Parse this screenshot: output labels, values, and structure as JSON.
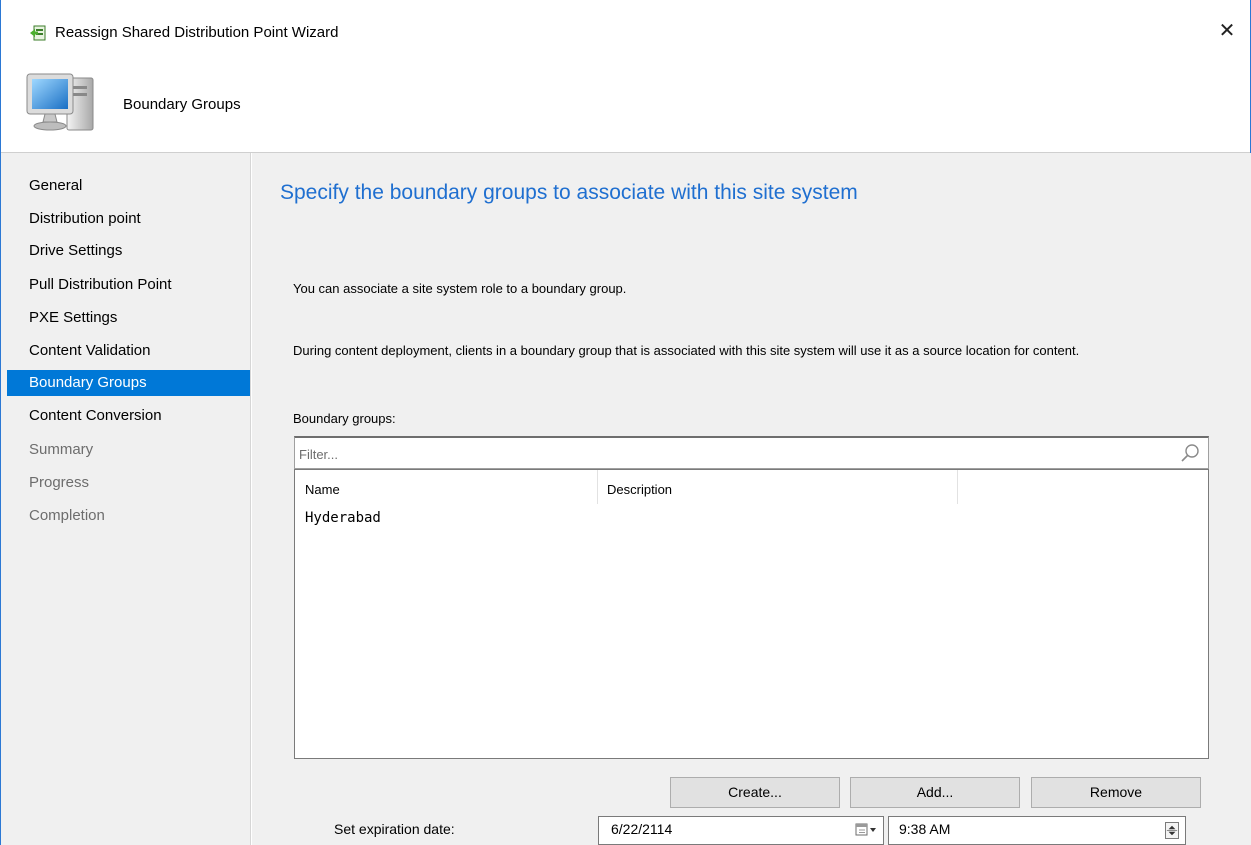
{
  "window": {
    "title": "Reassign Shared Distribution Point Wizard",
    "close_glyph": "✕"
  },
  "header": {
    "page_title": "Boundary Groups"
  },
  "nav": {
    "items": [
      {
        "label": "General",
        "state": "completed"
      },
      {
        "label": "Distribution point",
        "state": "completed"
      },
      {
        "label": "Drive Settings",
        "state": "completed"
      },
      {
        "label": "Pull Distribution Point",
        "state": "completed"
      },
      {
        "label": "PXE Settings",
        "state": "completed"
      },
      {
        "label": "Content Validation",
        "state": "completed"
      },
      {
        "label": "Boundary Groups",
        "state": "active"
      },
      {
        "label": "Content Conversion",
        "state": "completed"
      },
      {
        "label": "Summary",
        "state": "disabled"
      },
      {
        "label": "Progress",
        "state": "disabled"
      },
      {
        "label": "Completion",
        "state": "disabled"
      }
    ]
  },
  "main": {
    "heading": "Specify the boundary groups to associate with this site system",
    "intro": "You can associate a site system role to a boundary group.",
    "details": "During content deployment, clients in a boundary group that is associated with this site system will use it as a source location for content.",
    "list_label": "Boundary groups:",
    "filter": {
      "placeholder": "Filter...",
      "value": ""
    },
    "columns": [
      "Name",
      "Description"
    ],
    "rows": [
      {
        "name": "Hyderabad",
        "description": ""
      }
    ],
    "buttons": {
      "create": "Create...",
      "add": "Add...",
      "remove": "Remove"
    },
    "expiration": {
      "label": "Set expiration date:",
      "date": "6/22/2114",
      "time": "9:38 AM"
    }
  },
  "colors": {
    "accent": "#0078d7",
    "heading": "#1f6fd0",
    "panel": "#f0f0f0"
  }
}
